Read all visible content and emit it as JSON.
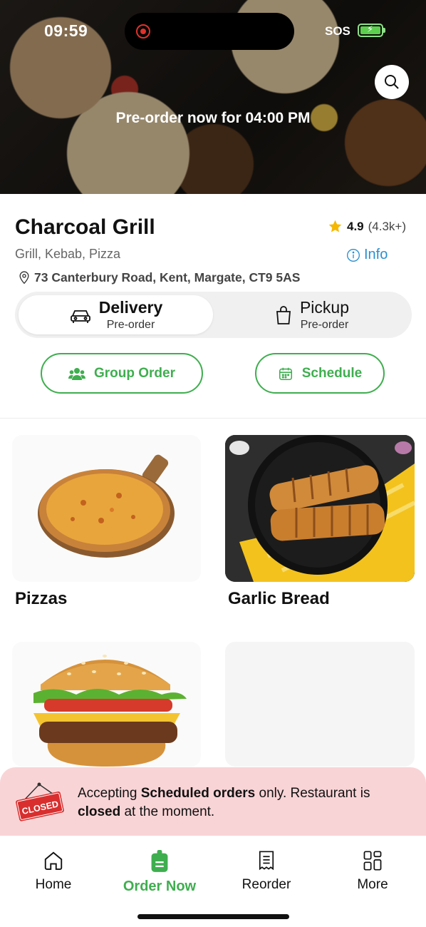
{
  "status_bar": {
    "time": "09:59",
    "sos": "SOS"
  },
  "hero": {
    "preorder_text": "Pre-order now for 04:00 PM"
  },
  "restaurant": {
    "name": "Charcoal Grill",
    "rating": "4.9",
    "rating_count": "(4.3k+)",
    "cuisines": "Grill, Kebab, Pizza",
    "info_label": "Info",
    "address": "73 Canterbury Road, Kent, Margate, CT9 5AS"
  },
  "order_mode": {
    "delivery": {
      "label": "Delivery",
      "sub": "Pre-order",
      "selected": true
    },
    "pickup": {
      "label": "Pickup",
      "sub": "Pre-order",
      "selected": false
    }
  },
  "actions": {
    "group_order": "Group Order",
    "schedule": "Schedule"
  },
  "categories": [
    {
      "name": "Pizzas"
    },
    {
      "name": "Garlic Bread"
    }
  ],
  "closed_notice": {
    "sign": "CLOSED",
    "part1": "Accepting ",
    "bold1": "Scheduled orders",
    "part2": " only. Restaurant is ",
    "bold2": "closed",
    "part3": " at the moment."
  },
  "bottom_nav": [
    {
      "label": "Home",
      "icon": "home-icon"
    },
    {
      "label": "Order Now",
      "icon": "order-icon",
      "active": true
    },
    {
      "label": "Reorder",
      "icon": "receipt-icon"
    },
    {
      "label": "More",
      "icon": "grid-icon"
    }
  ],
  "colors": {
    "accent": "#3fae4f",
    "info": "#2a8fd0",
    "notice_bg": "#f9d4d6",
    "star": "#f5b800"
  }
}
